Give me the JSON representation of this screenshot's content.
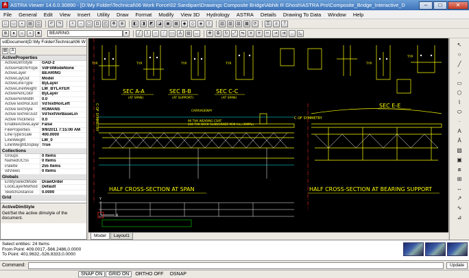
{
  "window": {
    "title": "ASTRA Viewer 14.6.0.30890 - [D:\\My Folder\\Technical\\06 Work Force\\02 Sandipan\\Drawings Composite Bridge\\Abhik R Ghosh\\ASTRA Pro\\Composite_Bridge_Interactive_D"
  },
  "menu": [
    "File",
    "General",
    "Edit",
    "View",
    "Insert",
    "Utility",
    "Draw",
    "Format",
    "Modify",
    "View 3D",
    "Hydrology",
    "ASTRA",
    "Details",
    "Drawing To Data",
    "Window",
    "Help"
  ],
  "toolbar": {
    "layer_value": "BEARING"
  },
  "panel": {
    "doc_path": "vdDocument(D:\\My Folder\\Technical\\06 W",
    "categories": [
      {
        "name": "ActiveProperties",
        "rows": [
          [
            "ActiveDimStyle",
            "GAD-2"
          ],
          [
            "ActiveHatchPrope",
            "VdFillModeNone"
          ],
          [
            "ActiveLayer",
            "BEARING"
          ],
          [
            "ActiveLayOut",
            "Model"
          ],
          [
            "ActiveLineType",
            "ByLayer"
          ],
          [
            "ActiveLineWeight",
            "LW_BYLAYER"
          ],
          [
            "ActivePenColor",
            "ByLayer"
          ],
          [
            "ActivePenWidth",
            "0.0"
          ],
          [
            "ActiveTextHorJust",
            "VdTextHorLeft"
          ],
          [
            "ActiveTextStyle",
            "ROMANS"
          ],
          [
            "ActiveTextVerJust",
            "VdTextVerBaseLin"
          ],
          [
            "ActiveThickness",
            "0.0"
          ],
          [
            "EnableActiveLayer",
            "False"
          ],
          [
            "FileProperties",
            "9/9/2011 7:15:00 AM"
          ],
          [
            "LineTypeScale",
            "400.0000"
          ],
          [
            "LineWeight",
            "LW_0"
          ],
          [
            "LineWeightDisplay",
            "True"
          ]
        ]
      },
      {
        "name": "Collections",
        "rows": [
          [
            "Groups",
            "0 Items"
          ],
          [
            "NamedUCSs",
            "0 Items"
          ],
          [
            "Palette",
            "255 Items"
          ],
          [
            "vdViews",
            "0 Items"
          ]
        ]
      },
      {
        "name": "Globals",
        "rows": [
          [
            "EntitySelectMode",
            "DrawOrder"
          ],
          [
            "LockLayerMethod",
            "Default"
          ],
          [
            "SketchDistance",
            "0.0000"
          ]
        ]
      },
      {
        "name": "Grid",
        "rows": []
      }
    ],
    "desc_title": "ActiveDimStyle",
    "desc_text": "Get/Set the active dimstyle of the document."
  },
  "drawing": {
    "sec_a": "SEC A-A",
    "sec_a_sub": "(AT SPAN)",
    "sec_b": "SEC B-B",
    "sec_b_sub": "(AT SUPPORT)",
    "sec_c": "SEC C-C",
    "sec_c_sub": "(AT SPAN)",
    "sec_e": "SEC E-E",
    "sym1": "C OF SYMMETRY",
    "sym2": "C OF SYMMETRY",
    "half_span": "HALF CROSS-SECTION AT SPAN",
    "half_bearing": "HALF CROSS-SECTION AT BEARING SUPPORT",
    "note1": "90 THK WEARING COAT",
    "note2": "240 THK DECK SLAB(GRADE M30 fck=30MPa)",
    "carriageway": "CARRIAGEWAY",
    "typ": "TYP.",
    "axis_x": "X",
    "axis_y": "Y"
  },
  "tabs": [
    "Model",
    "Layout1"
  ],
  "history": [
    "Select entities: 24 Items",
    "From Point: 409.0017,-566.2486,0.0000",
    "To Point: 401.9632,-526.8333,0.0000"
  ],
  "command": {
    "label": "Command:",
    "update": "Update"
  },
  "status": [
    "SNAP ON",
    "GRID ON",
    "ORTHO OFF",
    "OSNAP"
  ],
  "colors": {
    "cad_bg": "#000000",
    "line_yellow": "#ffff00",
    "line_white": "#ffffff",
    "line_red": "#ff2a2a",
    "line_cyan": "#00ffff",
    "line_green": "#00ff00"
  }
}
